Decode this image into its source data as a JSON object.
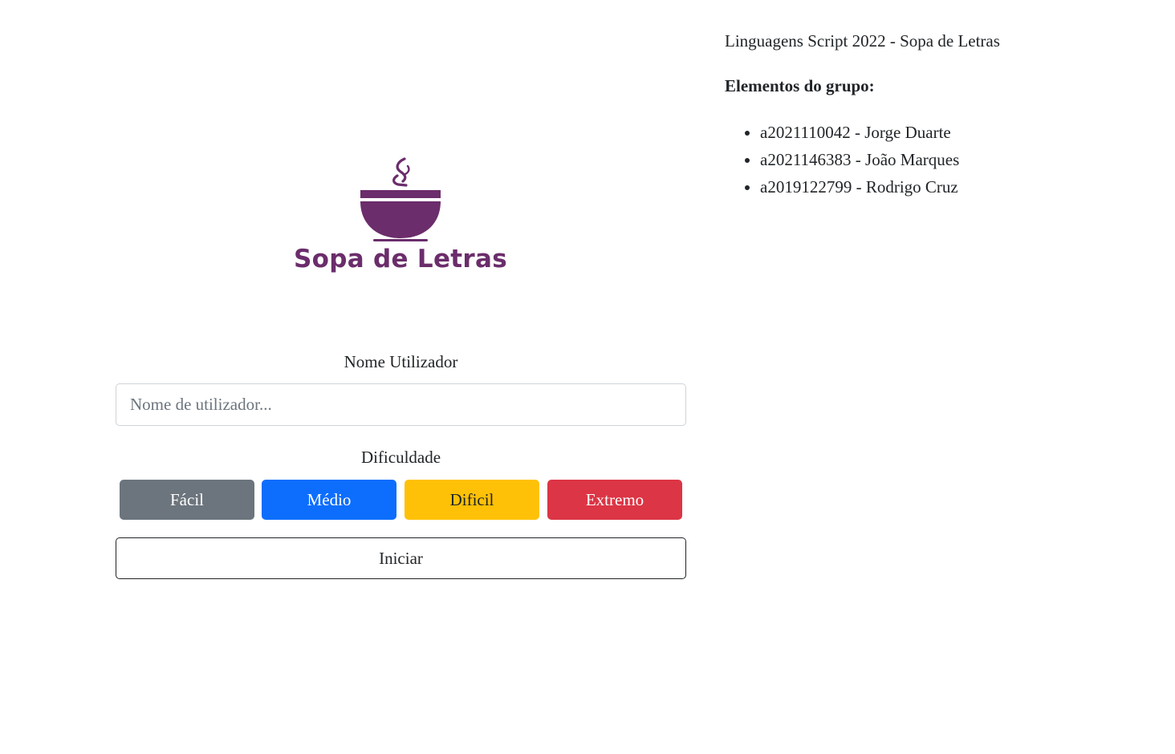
{
  "logo": {
    "text": "Sopa de Letras",
    "icon": "soup-bowl-icon",
    "color": "#6b2d6b"
  },
  "form": {
    "name_label": "Nome Utilizador",
    "name_placeholder": "Nome de utilizador...",
    "name_value": "",
    "difficulty_label": "Dificuldade",
    "difficulties": [
      {
        "label": "Fácil",
        "color": "#6c757d"
      },
      {
        "label": "Médio",
        "color": "#0d6efd"
      },
      {
        "label": "Dificil",
        "color": "#ffc107"
      },
      {
        "label": "Extremo",
        "color": "#dc3545"
      }
    ],
    "start_label": "Iniciar"
  },
  "info": {
    "title": "Linguagens Script 2022 - Sopa de Letras",
    "group_heading": "Elementos do grupo:",
    "members": [
      "a2021110042 - Jorge Duarte",
      "a2021146383 - João Marques",
      "a2019122799 - Rodrigo Cruz"
    ]
  }
}
